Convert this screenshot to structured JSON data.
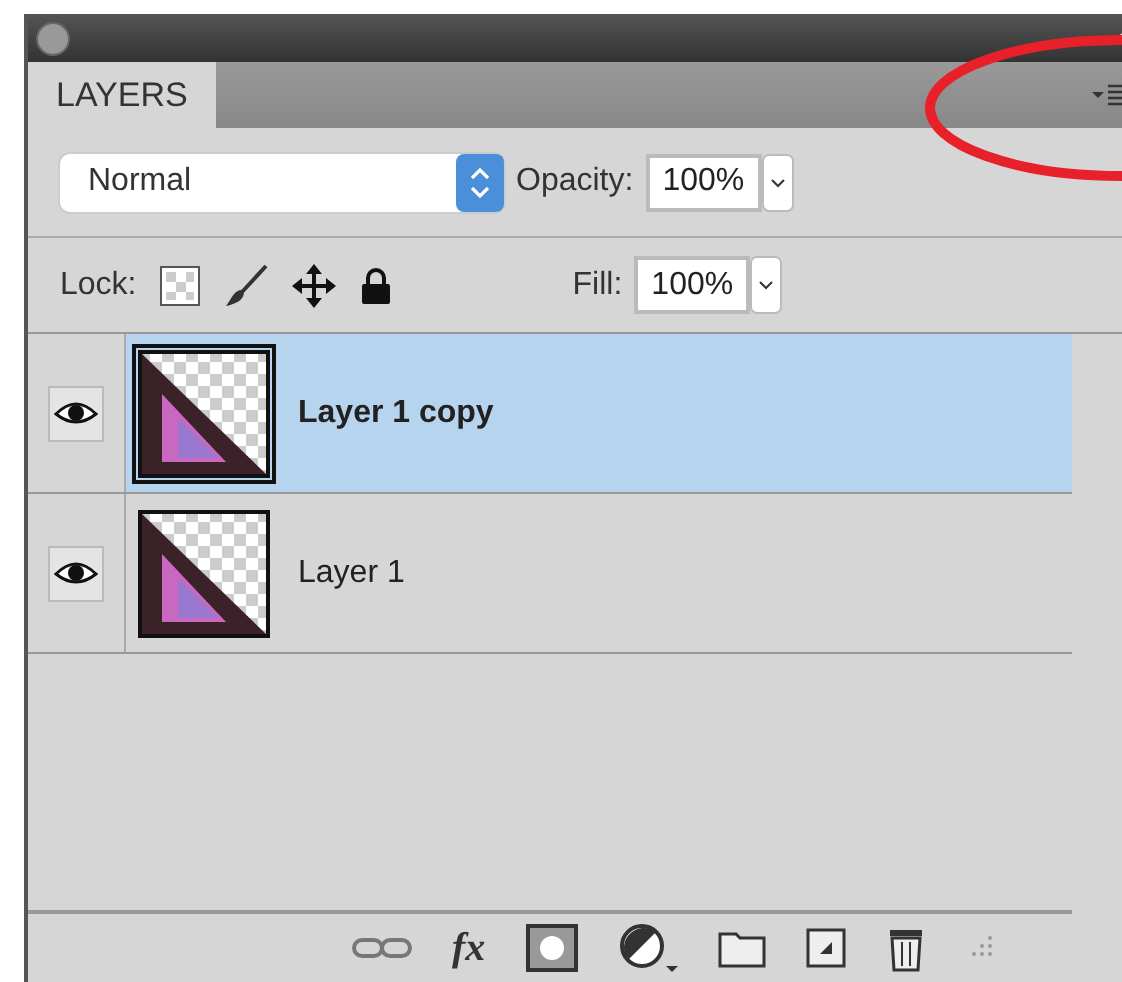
{
  "panel": {
    "tab": {
      "label": "LAYERS",
      "selected": true
    }
  },
  "blend": {
    "mode": "Normal",
    "opacity_label": "Opacity:",
    "opacity": "100%"
  },
  "lock": {
    "label": "Lock:",
    "fill_label": "Fill:",
    "fill": "100%"
  },
  "layers": [
    {
      "name": "Layer 1 copy",
      "visible": true,
      "selected": true
    },
    {
      "name": "Layer 1",
      "visible": true,
      "selected": false
    }
  ],
  "footer": {
    "effects_label": "fx"
  }
}
